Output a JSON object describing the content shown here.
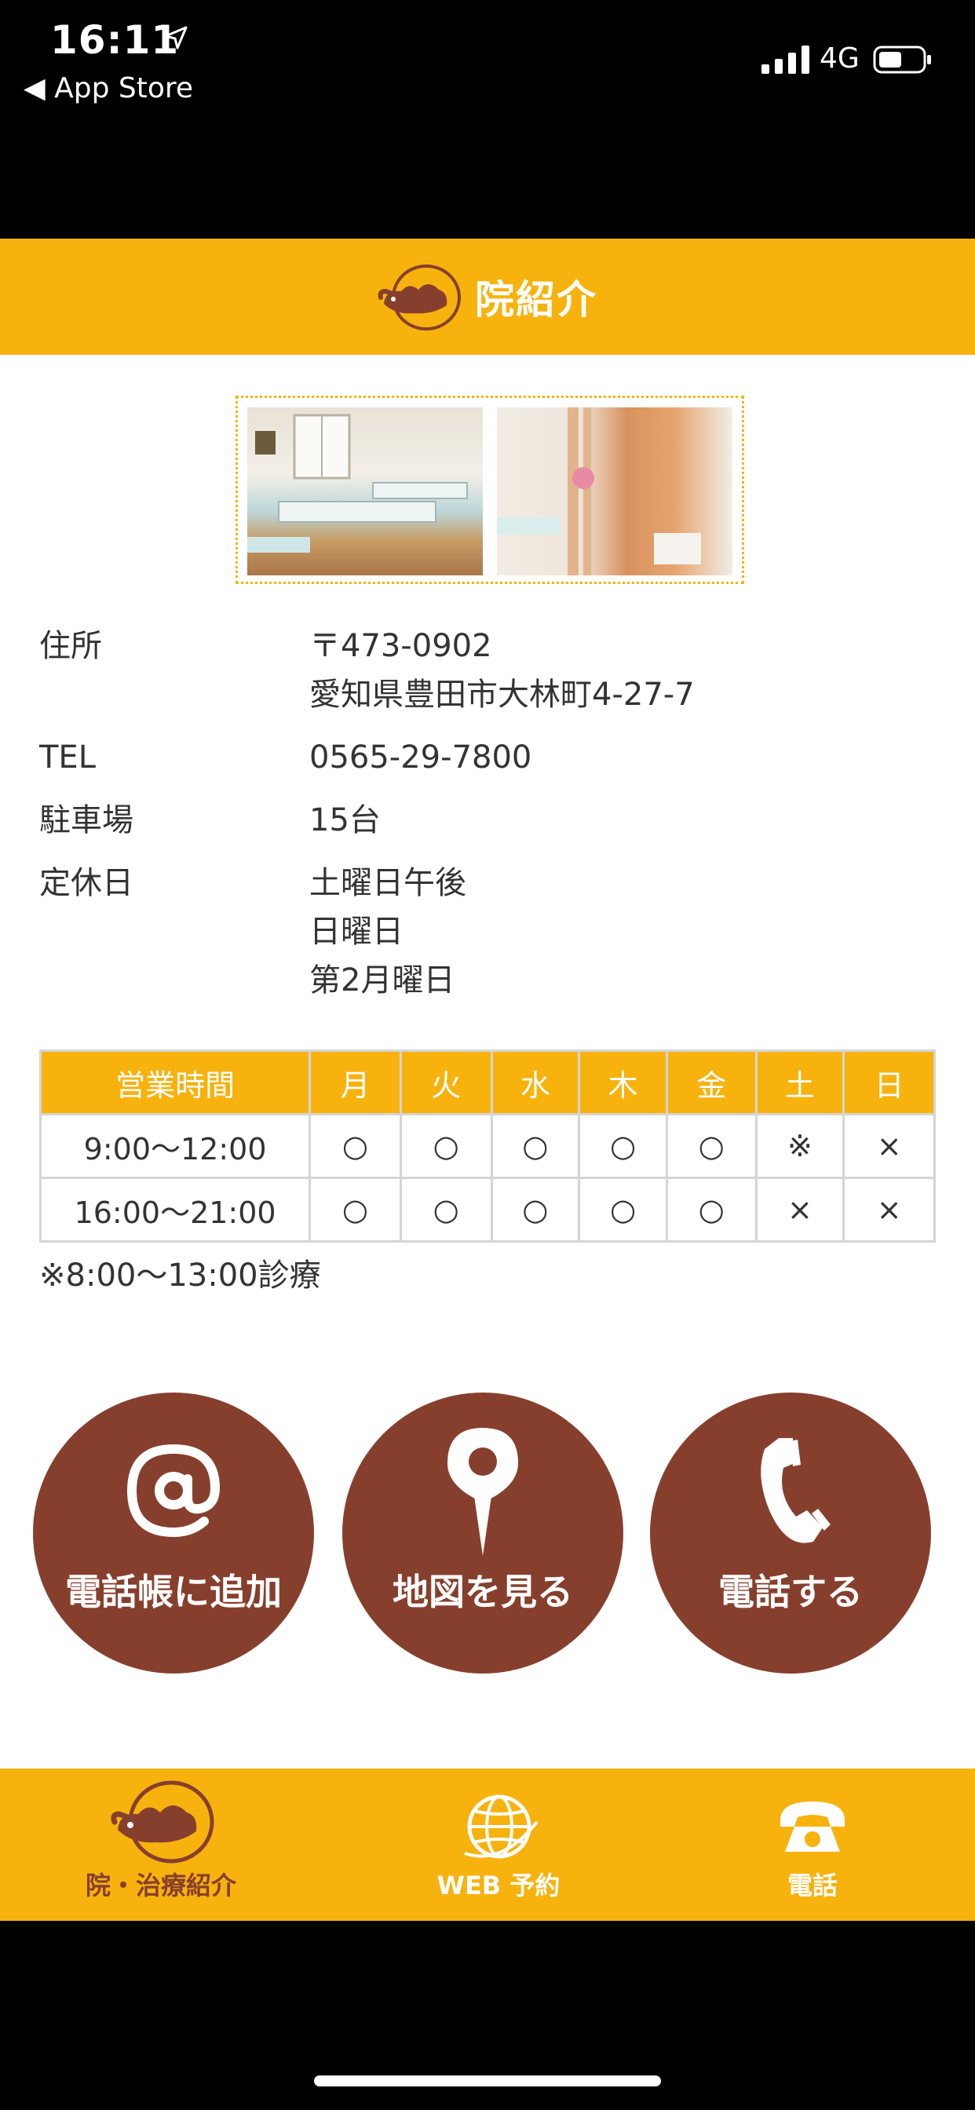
{
  "status_bar": {
    "time": "16:11",
    "back_label": "◀ App Store",
    "network": "4G"
  },
  "header": {
    "title": "院紹介",
    "logo_alt": "Rakuda Bonesetter's office"
  },
  "info": [
    {
      "label": "住所",
      "lines": [
        "〒473-0902",
        "愛知県豊田市大林町4-27-7"
      ]
    },
    {
      "label": "TEL",
      "lines": [
        "0565-29-7800"
      ]
    },
    {
      "label": "駐車場",
      "lines": [
        "15台"
      ]
    },
    {
      "label": "定休日",
      "lines": [
        "土曜日午後",
        "日曜日",
        "第2月曜日"
      ]
    }
  ],
  "hours_table": {
    "header": [
      "営業時間",
      "月",
      "火",
      "水",
      "木",
      "金",
      "土",
      "日"
    ],
    "rows": [
      [
        "9:00〜12:00",
        "○",
        "○",
        "○",
        "○",
        "○",
        "※",
        "×"
      ],
      [
        "16:00〜21:00",
        "○",
        "○",
        "○",
        "○",
        "○",
        "×",
        "×"
      ]
    ]
  },
  "note": "※8:00〜13:00診療",
  "actions": [
    {
      "label": "電話帳に追加",
      "icon": "at-icon"
    },
    {
      "label": "地図を見る",
      "icon": "map-pin-icon"
    },
    {
      "label": "電話する",
      "icon": "phone-handset-icon"
    }
  ],
  "tabbar": [
    {
      "label": "院・治療紹介",
      "icon": "camel-logo-icon"
    },
    {
      "label": "WEB 予約",
      "icon": "globe-icon"
    },
    {
      "label": "電話",
      "icon": "telephone-icon"
    }
  ],
  "colors": {
    "accent": "#F7B20E",
    "brown": "#873F2D"
  }
}
